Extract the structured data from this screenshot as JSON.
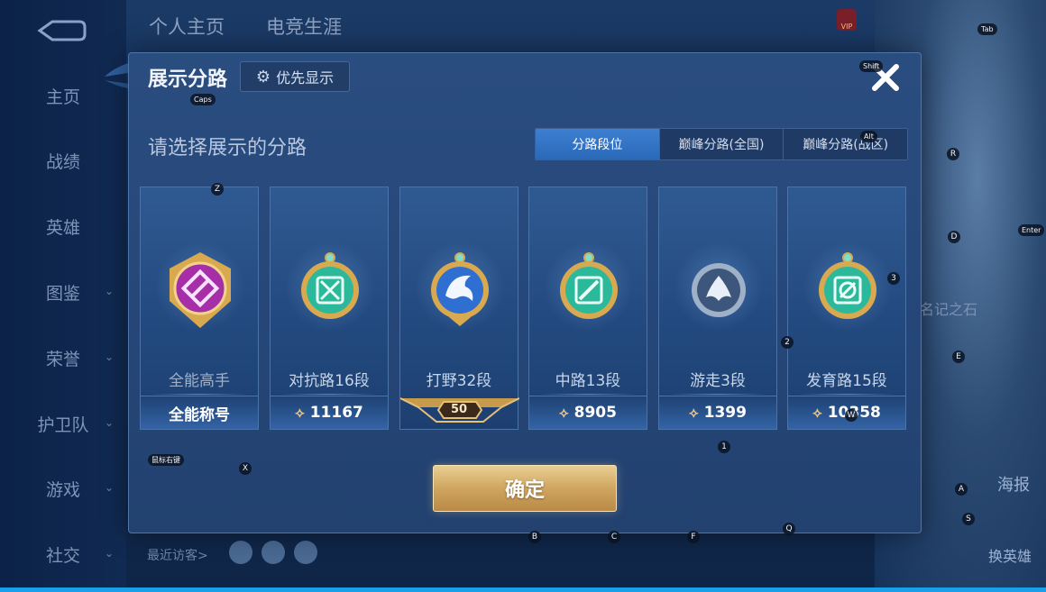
{
  "background": {
    "top_tabs": [
      "个人主页",
      "电竞生涯"
    ],
    "nav_items": [
      {
        "label": "主页",
        "has_chevron": false
      },
      {
        "label": "战绩",
        "has_chevron": false
      },
      {
        "label": "英雄",
        "has_chevron": false
      },
      {
        "label": "图鉴",
        "has_chevron": true
      },
      {
        "label": "荣誉",
        "has_chevron": true
      },
      {
        "label": "护卫队",
        "has_chevron": true
      },
      {
        "label": "游戏",
        "has_chevron": true
      },
      {
        "label": "社交",
        "has_chevron": true
      }
    ],
    "recent_visitors_label": "最近访客>",
    "right_labels": {
      "poster": "海报",
      "change_hero": "换英雄",
      "stone": "名记之石"
    },
    "vip_label": "VIP"
  },
  "dialog": {
    "title": "展示分路",
    "priority_button": "优先显示",
    "subtitle": "请选择展示的分路",
    "tabs": [
      {
        "label": "分路段位",
        "active": true
      },
      {
        "label": "巅峰分路(全国)",
        "active": false
      },
      {
        "label": "巅峰分路(战区)",
        "active": false
      }
    ],
    "cards": [
      {
        "name": "全能高手",
        "footer": "全能称号",
        "score": null,
        "emblem": "all-round-emblem",
        "color": "#b43db8"
      },
      {
        "name": "对抗路16段",
        "footer": null,
        "score": "11167",
        "emblem": "clash-lane-emblem",
        "color": "#27b59a"
      },
      {
        "name": "打野32段",
        "footer": null,
        "score": null,
        "level_badge": "50",
        "emblem": "jungle-emblem",
        "color": "#2f6fd2"
      },
      {
        "name": "中路13段",
        "footer": null,
        "score": "8905",
        "emblem": "mid-lane-emblem",
        "color": "#27b59a"
      },
      {
        "name": "游走3段",
        "footer": null,
        "score": "1399",
        "emblem": "roam-emblem",
        "color": "#7e95b6"
      },
      {
        "name": "发育路15段",
        "footer": null,
        "score": "10358",
        "emblem": "farm-lane-emblem",
        "color": "#27b59a"
      }
    ],
    "confirm_button": "确定"
  },
  "key_hints": {
    "caps": "Caps",
    "shift": "Shift",
    "alt": "Alt",
    "tab": "Tab",
    "enter": "Enter",
    "mouse_right": "鼠标右键",
    "z": "Z",
    "x": "X",
    "r": "R",
    "d": "D",
    "e": "E",
    "a": "A",
    "s": "S",
    "b": "B",
    "c": "C",
    "f": "F",
    "q": "Q",
    "w": "W",
    "one": "1",
    "two": "2",
    "three": "3"
  }
}
